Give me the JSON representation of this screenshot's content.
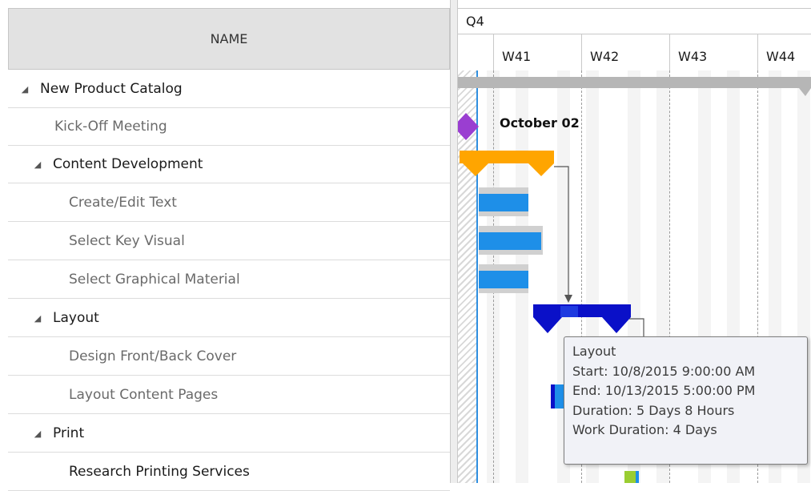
{
  "grid": {
    "name_header": "NAME"
  },
  "tasks": [
    {
      "label": "New Product Catalog",
      "expander": "◢"
    },
    {
      "label": "Kick-Off Meeting"
    },
    {
      "label": "Content Development",
      "expander": "◢"
    },
    {
      "label": "Create/Edit Text"
    },
    {
      "label": "Select Key Visual"
    },
    {
      "label": "Select Graphical Material"
    },
    {
      "label": "Layout",
      "expander": "◢"
    },
    {
      "label": "Design Front/Back Cover"
    },
    {
      "label": "Layout Content Pages"
    },
    {
      "label": "Print",
      "expander": "◢"
    },
    {
      "label": "Research Printing Services"
    }
  ],
  "timescale": {
    "quarter": "Q4",
    "weeks": [
      "W41",
      "W42",
      "W43",
      "W44"
    ]
  },
  "chart": {
    "milestone_label": "October 02",
    "colors": {
      "summary_top": "#b6b6b6",
      "content_dev": "#ffa500",
      "task_bar": "#1e8fe8",
      "layout_summary": "#0a10c8",
      "milestone": "#9a3ed1",
      "today_line": "#2f8fe0",
      "print_bar": "#9acd32"
    },
    "icons": [
      "milestone-diamond-icon"
    ]
  },
  "tooltip": {
    "title": "Layout",
    "start": "Start: 10/8/2015 9:00:00 AM",
    "end": "End: 10/13/2015 5:00:00 PM",
    "duration": "Duration: 5 Days 8 Hours",
    "work_duration": "Work Duration: 4 Days"
  }
}
